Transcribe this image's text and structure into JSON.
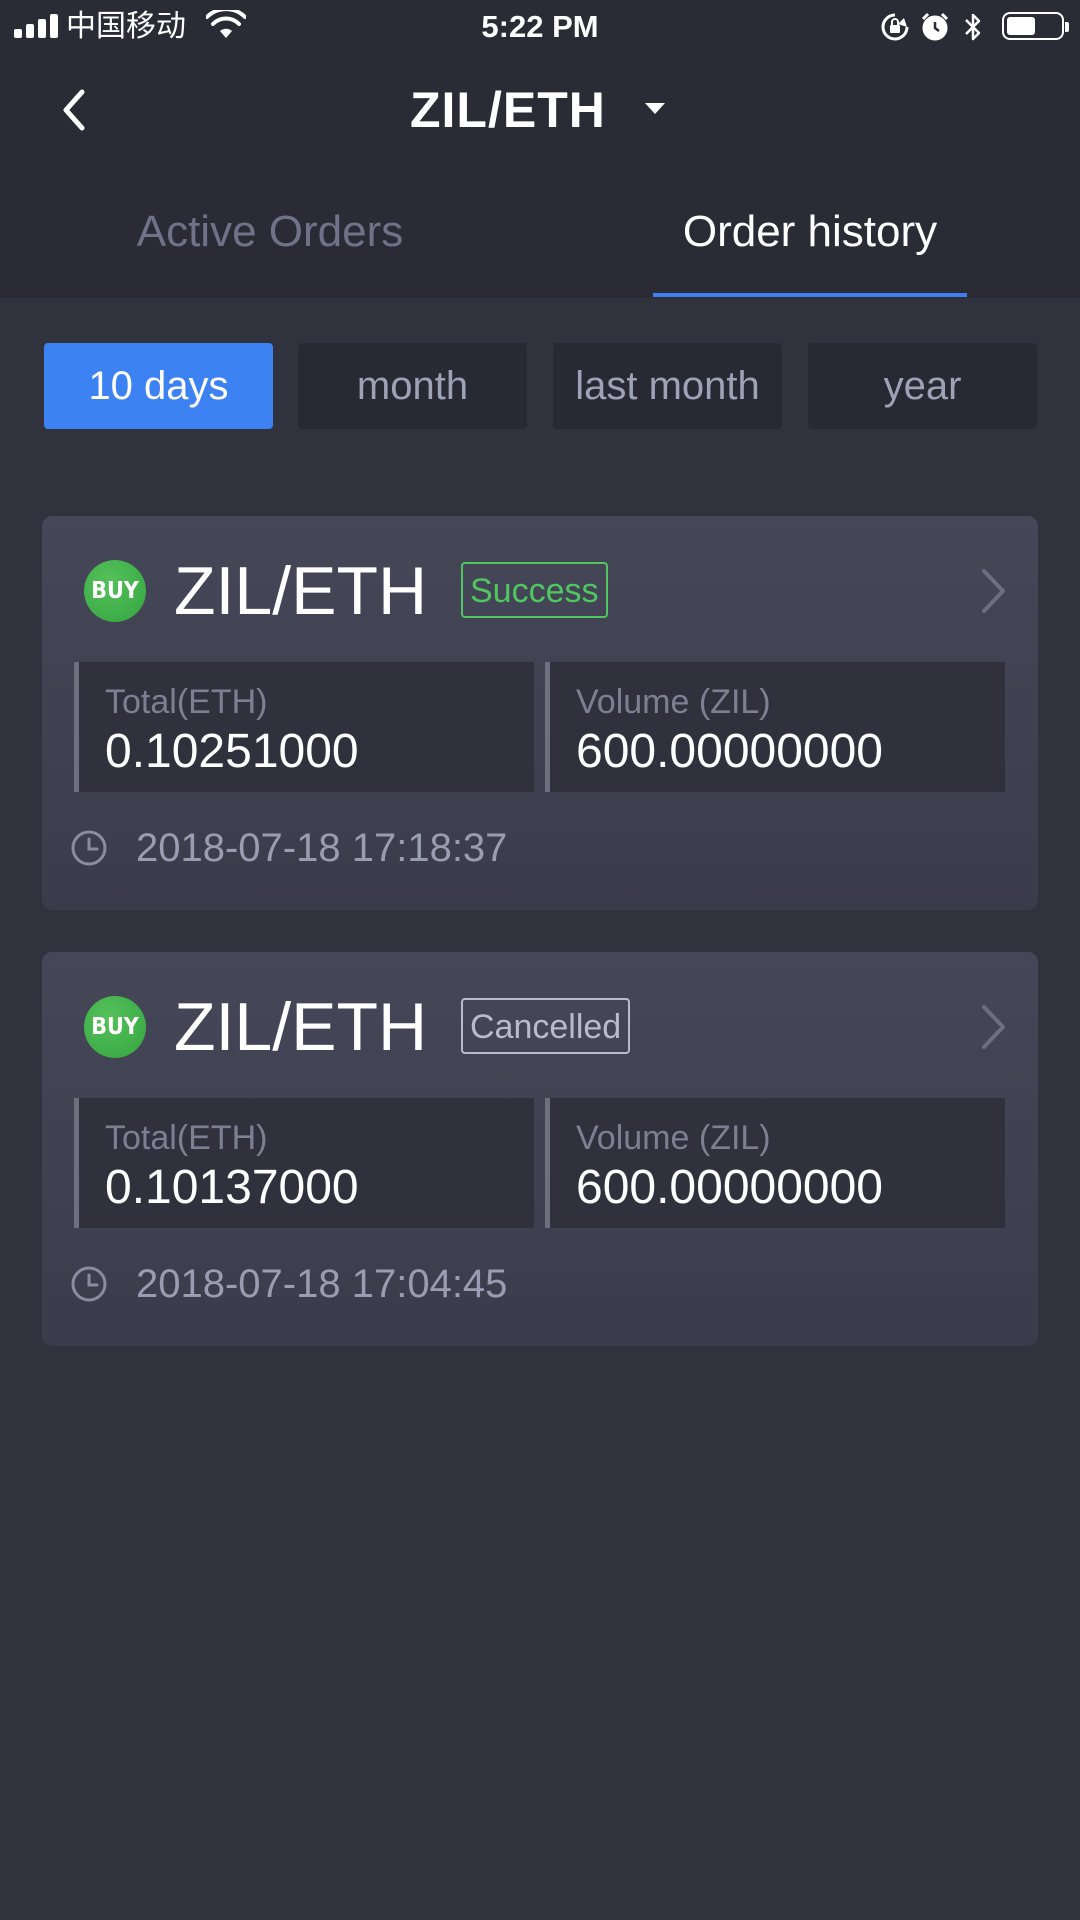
{
  "status_bar": {
    "carrier": "中国移动",
    "time": "5:22 PM",
    "icons": [
      "signal-icon",
      "wifi-icon",
      "rotation-lock-icon",
      "alarm-icon",
      "bluetooth-icon",
      "battery-icon"
    ],
    "battery_level": 0.5
  },
  "nav": {
    "title": "ZIL/ETH",
    "back_icon": "back-chevron-icon",
    "dropdown_icon": "caret-down-icon"
  },
  "tabs": [
    {
      "label": "Active Orders",
      "active": false
    },
    {
      "label": "Order history",
      "active": true
    }
  ],
  "filters": [
    {
      "label": "10 days",
      "active": true
    },
    {
      "label": "month",
      "active": false
    },
    {
      "label": "last month",
      "active": false
    },
    {
      "label": "year",
      "active": false
    }
  ],
  "orders": [
    {
      "side": "BUY",
      "pair": "ZIL/ETH",
      "status": "Success",
      "total_label": "Total(ETH)",
      "total": "0.10251000",
      "volume_label": "Volume (ZIL)",
      "volume": "600.00000000",
      "timestamp": "2018-07-18 17:18:37"
    },
    {
      "side": "BUY",
      "pair": "ZIL/ETH",
      "status": "Cancelled",
      "total_label": "Total(ETH)",
      "total": "0.10137000",
      "volume_label": "Volume (ZIL)",
      "volume": "600.00000000",
      "timestamp": "2018-07-18 17:04:45"
    }
  ],
  "colors": {
    "accent": "#3d82f2",
    "success": "#4fc660",
    "cancelled": "#b8bbcc",
    "buy": "#3fae4a",
    "background": "#30323d",
    "header": "#2a2b35"
  }
}
